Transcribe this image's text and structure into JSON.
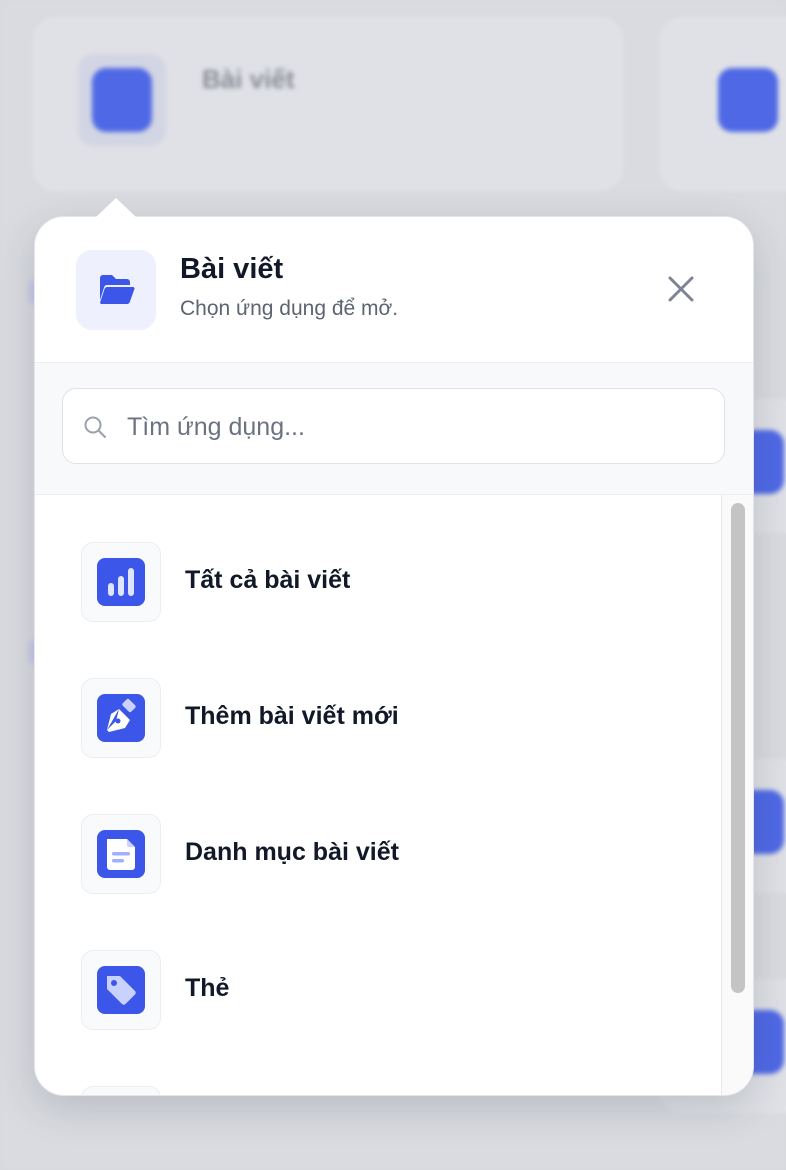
{
  "popover": {
    "title": "Bài viết",
    "subtitle": "Chọn ứng dụng để mở.",
    "header_icon": "folder-open-icon",
    "close_icon": "close-icon"
  },
  "search": {
    "placeholder": "Tìm ứng dụng..."
  },
  "apps": [
    {
      "label": "Tất cả bài viết",
      "icon": "bar-chart-icon"
    },
    {
      "label": "Thêm bài viết mới",
      "icon": "pen-nib-icon"
    },
    {
      "label": "Danh mục bài viết",
      "icon": "document-icon"
    },
    {
      "label": "Thẻ",
      "icon": "tag-icon"
    }
  ],
  "colors": {
    "accent": "#3b56e8",
    "icon_bg": "#eef0fd",
    "text_primary": "#111827",
    "text_secondary": "#5d6472"
  }
}
